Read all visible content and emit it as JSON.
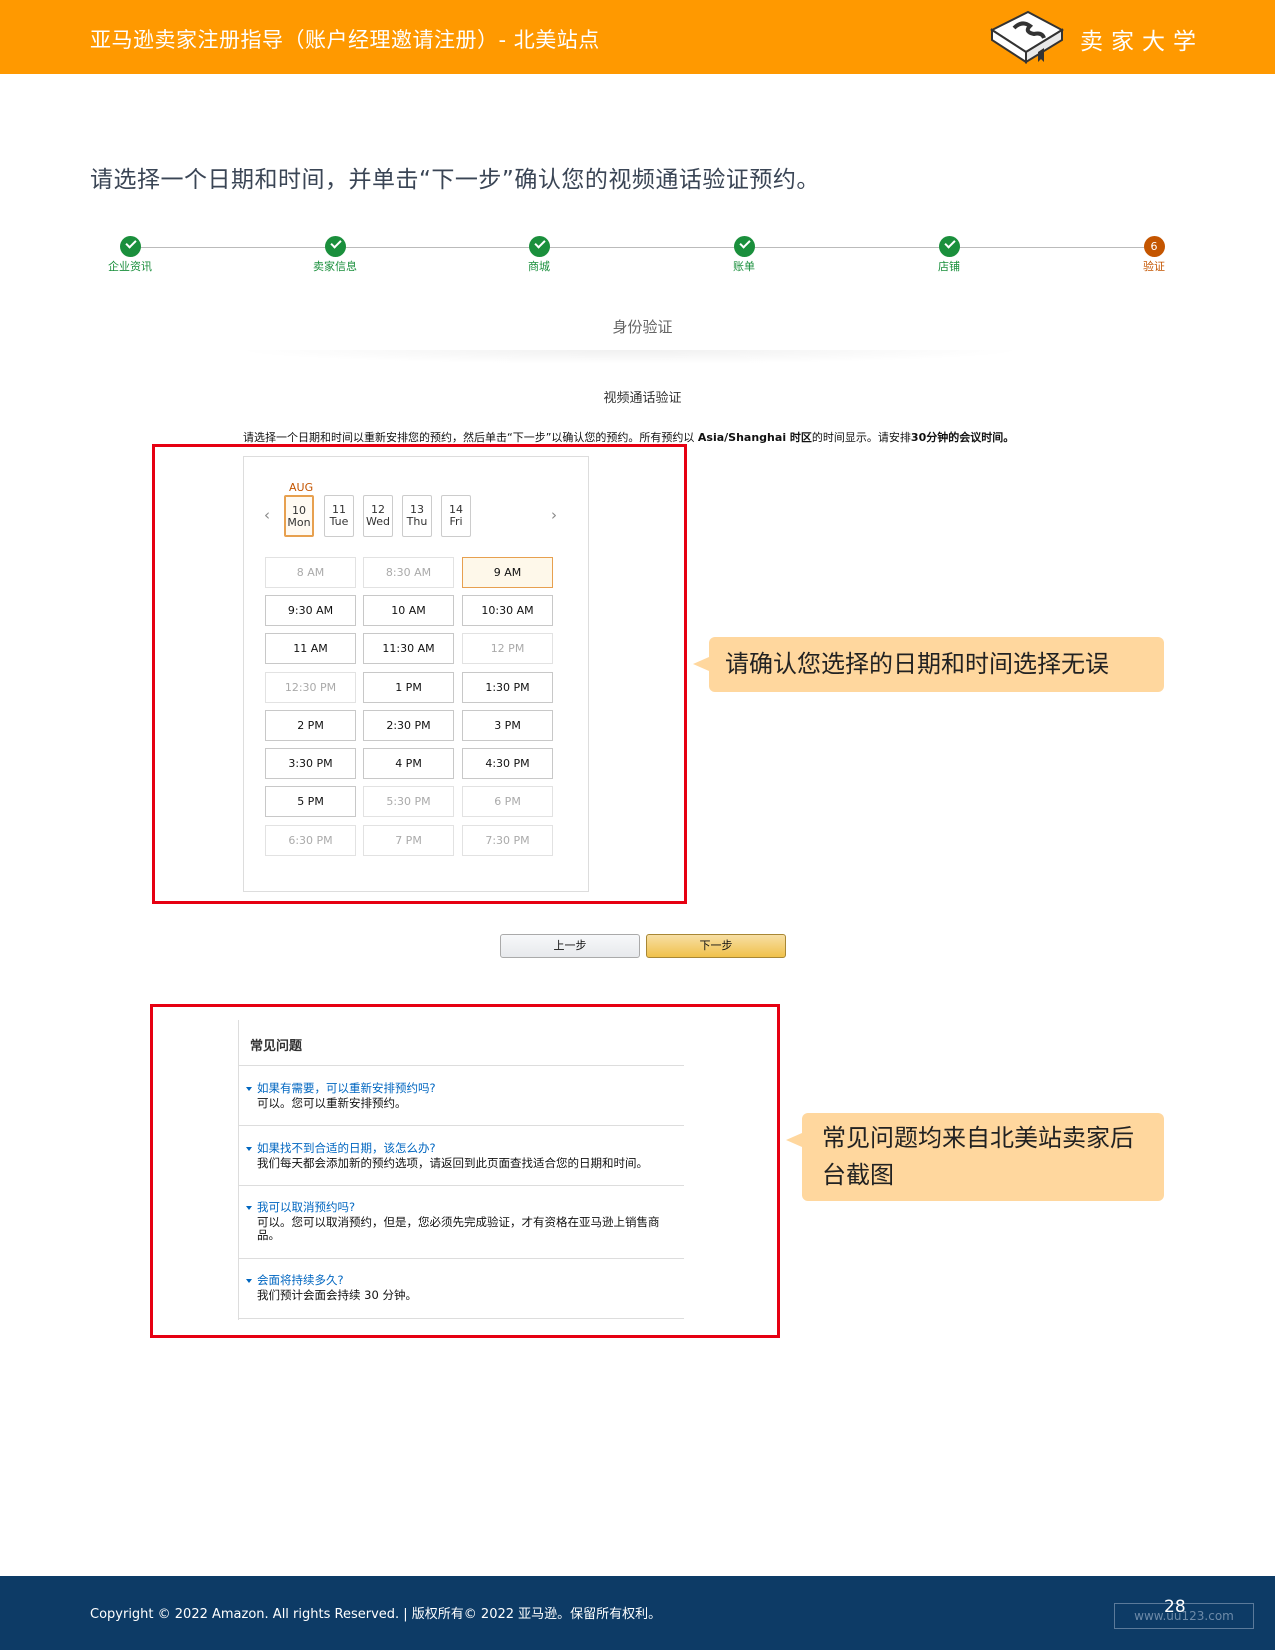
{
  "header": {
    "title": "亚马逊卖家注册指导（账户经理邀请注册）- 北美站点",
    "logo_text": "卖家大学",
    "logo_icon": "book-logo-icon",
    "brand_color": "#FF9900"
  },
  "main_title": "请选择一个日期和时间，并单击“下一步”确认您的视频通话验证预约。",
  "stepper": {
    "steps": [
      {
        "label": "企业资讯",
        "status": "done"
      },
      {
        "label": "卖家信息",
        "status": "done"
      },
      {
        "label": "商城",
        "status": "done"
      },
      {
        "label": "账单",
        "status": "done"
      },
      {
        "label": "店铺",
        "status": "done"
      },
      {
        "label": "验证",
        "status": "current",
        "number": "6"
      }
    ]
  },
  "section_label": "身份验证",
  "subheading": "视频通话验证",
  "instruction": {
    "text1": "请选择一个日期和时间以重新安排您的预约，然后单击“下一步”以确认您的预约。所有预约以 ",
    "bold1": "Asia/Shanghai 时区",
    "text2": "的时间显示。请安排",
    "bold2": "30分钟的会议时间。"
  },
  "calendar": {
    "month": "AUG",
    "days": [
      {
        "num": "10",
        "dow": "Mon",
        "selected": true
      },
      {
        "num": "11",
        "dow": "Tue",
        "selected": false
      },
      {
        "num": "12",
        "dow": "Wed",
        "selected": false
      },
      {
        "num": "13",
        "dow": "Thu",
        "selected": false
      },
      {
        "num": "14",
        "dow": "Fri",
        "selected": false
      }
    ],
    "prev_icon": "‹",
    "next_icon": "›",
    "slots": [
      {
        "t": "8 AM",
        "s": "disabled"
      },
      {
        "t": "8:30 AM",
        "s": "disabled"
      },
      {
        "t": "9 AM",
        "s": "selected"
      },
      {
        "t": "9:30 AM",
        "s": "available"
      },
      {
        "t": "10 AM",
        "s": "available"
      },
      {
        "t": "10:30 AM",
        "s": "available"
      },
      {
        "t": "11 AM",
        "s": "available"
      },
      {
        "t": "11:30 AM",
        "s": "available"
      },
      {
        "t": "12 PM",
        "s": "disabled"
      },
      {
        "t": "12:30 PM",
        "s": "disabled"
      },
      {
        "t": "1 PM",
        "s": "available"
      },
      {
        "t": "1:30 PM",
        "s": "available"
      },
      {
        "t": "2 PM",
        "s": "available"
      },
      {
        "t": "2:30 PM",
        "s": "available"
      },
      {
        "t": "3 PM",
        "s": "available"
      },
      {
        "t": "3:30 PM",
        "s": "available"
      },
      {
        "t": "4 PM",
        "s": "available"
      },
      {
        "t": "4:30 PM",
        "s": "available"
      },
      {
        "t": "5 PM",
        "s": "available"
      },
      {
        "t": "5:30 PM",
        "s": "disabled"
      },
      {
        "t": "6 PM",
        "s": "disabled"
      },
      {
        "t": "6:30 PM",
        "s": "disabled"
      },
      {
        "t": "7 PM",
        "s": "disabled"
      },
      {
        "t": "7:30 PM",
        "s": "disabled"
      }
    ]
  },
  "buttons": {
    "prev": "上一步",
    "next": "下一步"
  },
  "callouts": {
    "calendar_note": "请确认您选择的日期和时间选择无误",
    "faq_note_line1": "常见问题均来自北美站卖家后",
    "faq_note_line2": "台截图"
  },
  "faq": {
    "title": "常见问题",
    "items": [
      {
        "q": "如果有需要，可以重新安排预约吗?",
        "a": "可以。您可以重新安排预约。"
      },
      {
        "q": "如果找不到合适的日期，该怎么办?",
        "a": "我们每天都会添加新的预约选项，请返回到此页面查找适合您的日期和时间。"
      },
      {
        "q": "我可以取消预约吗?",
        "a": "可以。您可以取消预约，但是，您必须先完成验证，才有资格在亚马逊上销售商品。"
      },
      {
        "q": "会面将持续多久?",
        "a": "我们预计会面会持续 30 分钟。"
      }
    ]
  },
  "footer": {
    "copyright": "Copyright © 2022 Amazon. All rights Reserved. | 版权所有© 2022 亚马逊。保留所有权利。",
    "watermark": "www.uu123.com",
    "page_number": "28"
  }
}
